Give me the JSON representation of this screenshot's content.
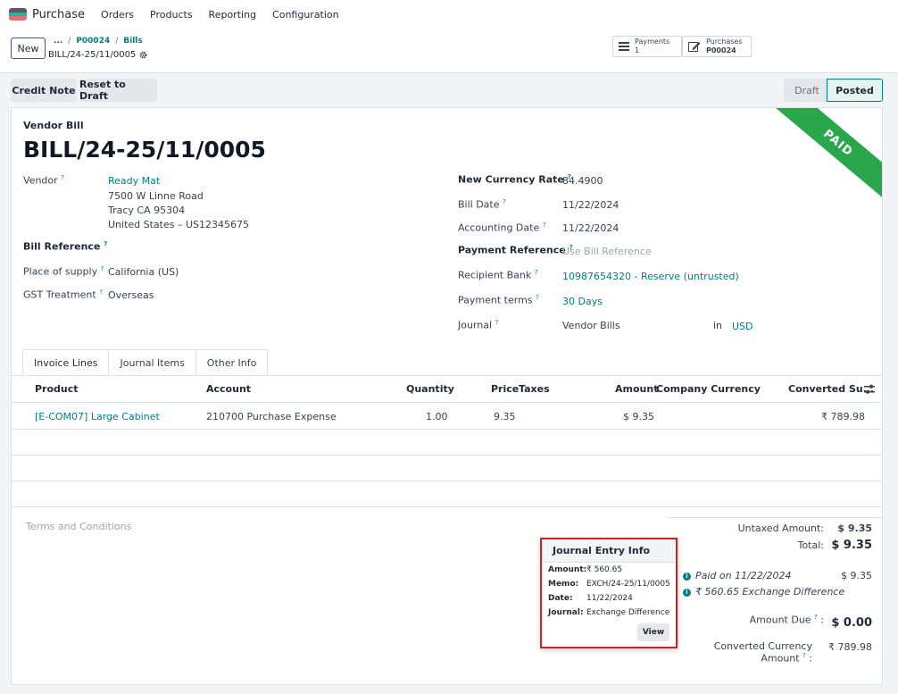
{
  "nav": {
    "app_name": "Purchase",
    "menu": [
      "Orders",
      "Products",
      "Reporting",
      "Configuration"
    ]
  },
  "control": {
    "new_label": "New",
    "breadcrumb": [
      "...",
      "P00024",
      "Bills"
    ],
    "record_name": "BILL/24-25/11/0005",
    "payments": {
      "label": "Payments",
      "count": "1"
    },
    "purchases": {
      "label": "Purchases",
      "ref": "P00024"
    }
  },
  "actions": {
    "credit_note": "Credit Note",
    "reset_to_draft": "Reset to Draft",
    "status_draft": "Draft",
    "status_posted": "Posted"
  },
  "sheet": {
    "ribbon": "PAID",
    "doc_type": "Vendor Bill",
    "title": "BILL/24-25/11/0005",
    "left_fields": {
      "vendor_label": "Vendor",
      "vendor_name": "Ready Mat",
      "vendor_address_1": "7500 W Linne Road",
      "vendor_address_2": "Tracy CA 95304",
      "vendor_address_3": "United States – US12345675",
      "bill_ref_label": "Bill Reference",
      "place_of_supply_label": "Place of supply",
      "place_of_supply": "California (US)",
      "gst_label": "GST Treatment",
      "gst": "Overseas"
    },
    "right_fields": {
      "currency_rate_label": "New Currency Rate",
      "currency_rate": "84.4900",
      "bill_date_label": "Bill Date",
      "bill_date": "11/22/2024",
      "accounting_date_label": "Accounting Date",
      "accounting_date": "11/22/2024",
      "payment_ref_label": "Payment Reference",
      "payment_ref_placeholder": "Use Bill Reference",
      "recipient_bank_label": "Recipient Bank",
      "recipient_bank": "10987654320 - Reserve (untrusted)",
      "payment_terms_label": "Payment terms",
      "payment_terms": "30 Days",
      "journal_label": "Journal",
      "journal": "Vendor Bills",
      "in_label": "in",
      "currency": "USD"
    },
    "help_mark": "?",
    "tabs": [
      "Invoice Lines",
      "Journal Items",
      "Other Info"
    ],
    "table": {
      "headers": [
        "Product",
        "Account",
        "Quantity",
        "Price",
        "Taxes",
        "Amount",
        "Company Currency",
        "Converted Su..."
      ],
      "rows": [
        {
          "product": "[E-COM07] Large Cabinet",
          "account": "210700 Purchase Expense",
          "quantity": "1.00",
          "price": "9.35",
          "taxes": "",
          "amount": "$ 9.35",
          "company_currency": "",
          "converted": "₹ 789.98"
        }
      ]
    },
    "terms_placeholder": "Terms and Conditions",
    "totals": {
      "untaxed_label": "Untaxed Amount:",
      "untaxed": "$ 9.35",
      "total_label": "Total:",
      "total": "$ 9.35",
      "paid_on": "Paid on 11/22/2024",
      "paid_amount": "$ 9.35",
      "exchange_diff": "₹ 560.65 Exchange Difference",
      "amount_due_label": "Amount Due",
      "amount_due": "$ 0.00",
      "converted_label": "Converted Currency Amount",
      "converted": "₹ 789.98"
    }
  },
  "popover": {
    "title": "Journal Entry Info",
    "amount_label": "Amount:",
    "amount": "₹ 560.65",
    "memo_label": "Memo:",
    "memo": "EXCH/24-25/11/0005",
    "date_label": "Date:",
    "date": "11/22/2024",
    "journal_label": "Journal:",
    "journal": "Exchange Difference",
    "view_label": "View"
  },
  "colors": {
    "accent": "#017e84",
    "ribbon": "#2aa74a",
    "highlight": "#d61f1f"
  }
}
